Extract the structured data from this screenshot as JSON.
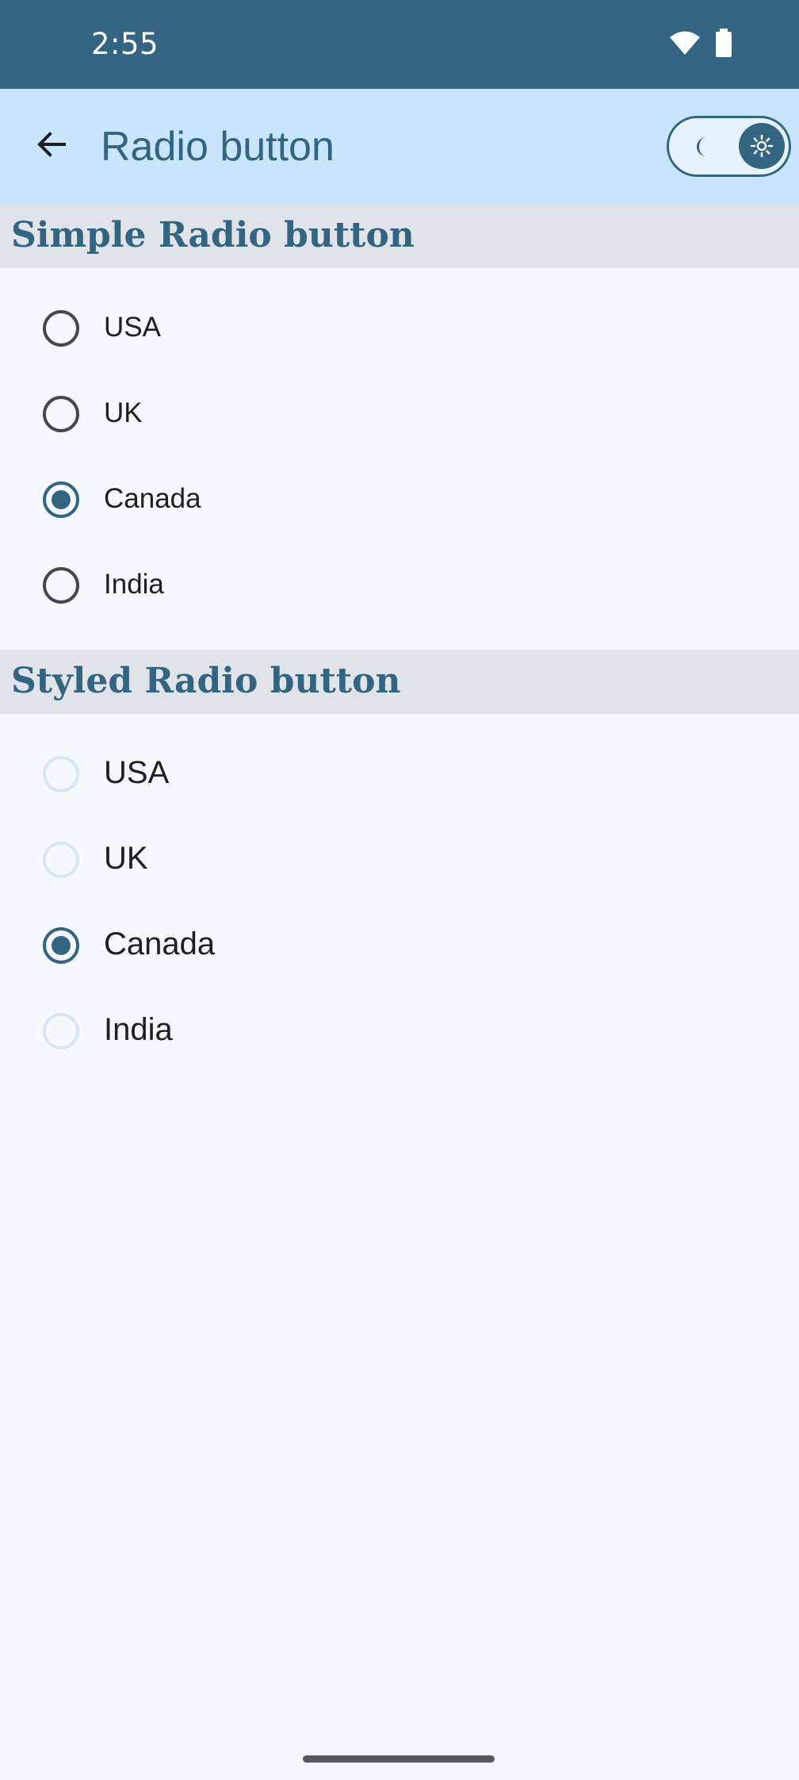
{
  "status_bar": {
    "time": "2:55",
    "icons": [
      "wifi-icon",
      "battery-icon"
    ]
  },
  "app_bar": {
    "back_icon": "arrow-left-icon",
    "title": "Radio button",
    "theme_toggle": {
      "left_icon": "moon-icon",
      "right_icon": "sun-icon",
      "selected": "light"
    }
  },
  "sections": [
    {
      "title": "Simple Radio button",
      "options": [
        {
          "label": "USA",
          "checked": false
        },
        {
          "label": "UK",
          "checked": false
        },
        {
          "label": "Canada",
          "checked": true
        },
        {
          "label": "India",
          "checked": false
        }
      ]
    },
    {
      "title": "Styled Radio button",
      "options": [
        {
          "label": "USA",
          "checked": false
        },
        {
          "label": "UK",
          "checked": false
        },
        {
          "label": "Canada",
          "checked": true
        },
        {
          "label": "India",
          "checked": false
        }
      ]
    }
  ],
  "colors": {
    "primary": "#336582",
    "app_bar": "#c8e5fb",
    "background": "#f5f9fe",
    "section_header": "#e0e3e7"
  }
}
